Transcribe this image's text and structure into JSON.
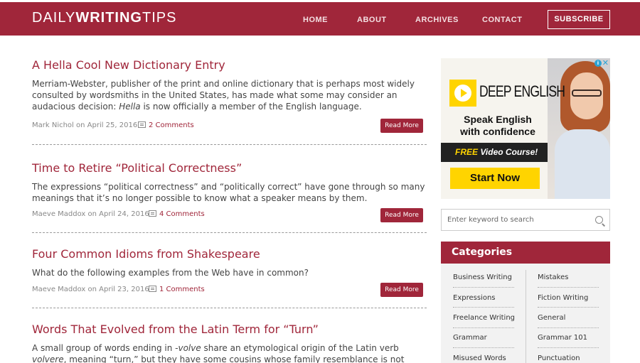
{
  "header": {
    "logo_thin_1": "DAILY",
    "logo_bold": "WRITING",
    "logo_thin_2": "TIPS",
    "nav": [
      "HOME",
      "ABOUT",
      "ARCHIVES",
      "CONTACT"
    ],
    "subscribe": "SUBSCRIBE",
    "brand_color": "#a0263a"
  },
  "posts": [
    {
      "title": "A Hella Cool New Dictionary Entry",
      "excerpt_before": "Merriam-Webster, publisher of the print and online dictionary that is perhaps most widely consulted by wordsmiths in the United States, has made what some may consider an audacious decision: ",
      "excerpt_em": "Hella",
      "excerpt_after": " is now officially a member of the English language.",
      "meta": "Mark Nichol on April 25, 2016",
      "comments": "2 Comments",
      "read_more": "Read More"
    },
    {
      "title": "Time to Retire “Political Correctness”",
      "excerpt_before": "The expressions “political correctness” and “politically correct” have gone through so many meanings that it’s no longer possible to know what a speaker means by them.",
      "excerpt_em": "",
      "excerpt_after": "",
      "meta": "Maeve Maddox on April 24, 2016",
      "comments": "4 Comments",
      "read_more": "Read More"
    },
    {
      "title": "Four Common Idioms from Shakespeare",
      "excerpt_before": "What do the following examples from the Web have in common?",
      "excerpt_em": "",
      "excerpt_after": "",
      "meta": "Maeve Maddox on April 23, 2016",
      "comments": "1 Comments",
      "read_more": "Read More"
    },
    {
      "title": "Words That Evolved from the Latin Term for “Turn”",
      "excerpt_1": "A small group of words ending in ",
      "excerpt_em1": "-volve",
      "excerpt_2": " share an etymological origin of the Latin verb ",
      "excerpt_em2": "volvere",
      "excerpt_3": ", meaning “turn,” but they have some cousins whose family resemblance is not obvious. Here are some expected"
    }
  ],
  "ad": {
    "brand": "DEEP ENGLISH",
    "tagline_1": "Speak English",
    "tagline_2": "with confidence",
    "banner_free": "FREE",
    "banner_rest": " Video Course!",
    "cta": "Start Now",
    "info": "i",
    "close": "✕"
  },
  "search": {
    "placeholder": "Enter keyword to search"
  },
  "categories": {
    "title": "Categories",
    "left": [
      "Business Writing",
      "Expressions",
      "Freelance Writing",
      "Grammar",
      "Misused Words"
    ],
    "right": [
      "Mistakes",
      "Fiction Writing",
      "General",
      "Grammar 101",
      "Punctuation"
    ]
  }
}
